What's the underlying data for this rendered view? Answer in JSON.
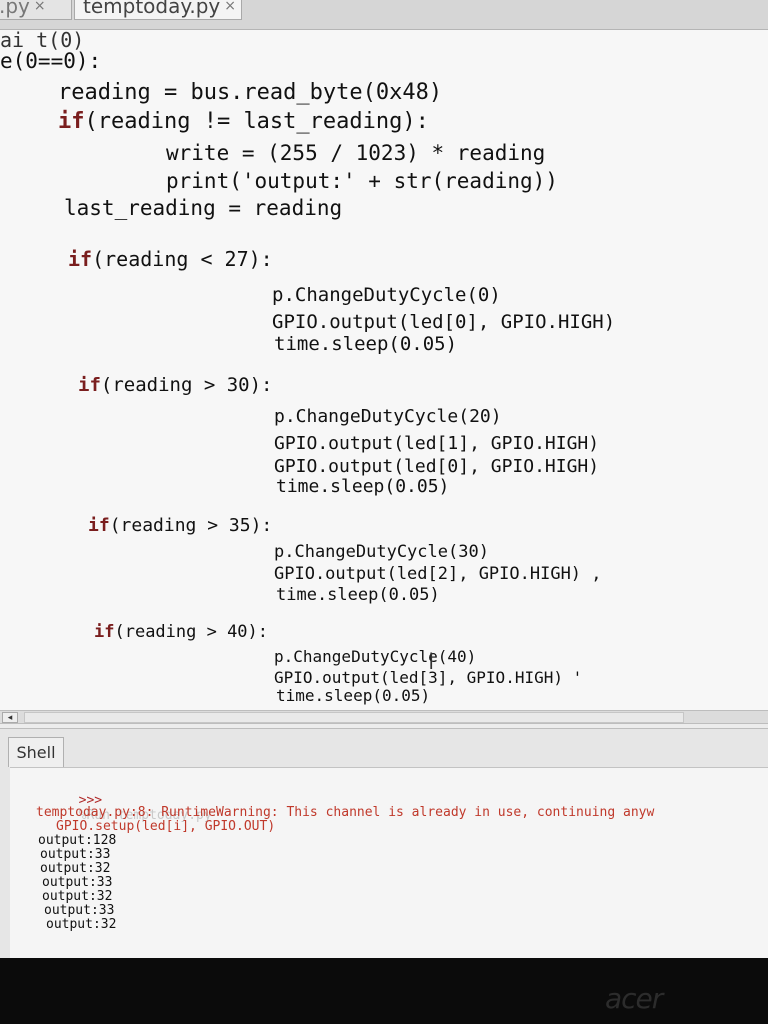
{
  "tabs": [
    {
      "label": ".py",
      "close": "×"
    },
    {
      "label": "temptoday.py",
      "close": "×"
    }
  ],
  "editor": {
    "lines": [
      "ai t(0)",
      "e(0==0):",
      "reading = bus.read_byte(0x48)",
      "if(reading != last_reading):",
      "write = (255 / 1023) * reading",
      "print('output:' + str(reading))",
      "last_reading = reading",
      "if(reading < 27):",
      "p.ChangeDutyCycle(0)",
      "GPIO.output(led[0], GPIO.HIGH)",
      "time.sleep(0.05)",
      "if(reading > 30):",
      "p.ChangeDutyCycle(20)",
      "GPIO.output(led[1], GPIO.HIGH)",
      "GPIO.output(led[0], GPIO.HIGH)",
      "time.sleep(0.05)",
      "if(reading > 35):",
      "p.ChangeDutyCycle(30)",
      "GPIO.output(led[2], GPIO.HIGH) ,",
      "time.sleep(0.05)",
      "if(reading > 40):",
      "p.ChangeDutyCycle(40)",
      "GPIO.output(led[3], GPIO.HIGH) '",
      "time.sleep(0.05)"
    ],
    "cursor_glyph": "I"
  },
  "scrollbar": {
    "left_arrow": "◂"
  },
  "shell": {
    "tab_label": "Shell",
    "prompt": ">>>",
    "run_command": "%Run temptoday.py",
    "warning_line": "temptoday.py:8: RuntimeWarning: This channel is already in use, continuing anyw",
    "warning_source": "GPIO.setup(led[i], GPIO.OUT)",
    "outputs": [
      "output:128",
      "output:33",
      "output:32",
      "output:33",
      "output:32",
      "output:33",
      "output:32"
    ]
  },
  "monitor": {
    "brand": "acer"
  }
}
